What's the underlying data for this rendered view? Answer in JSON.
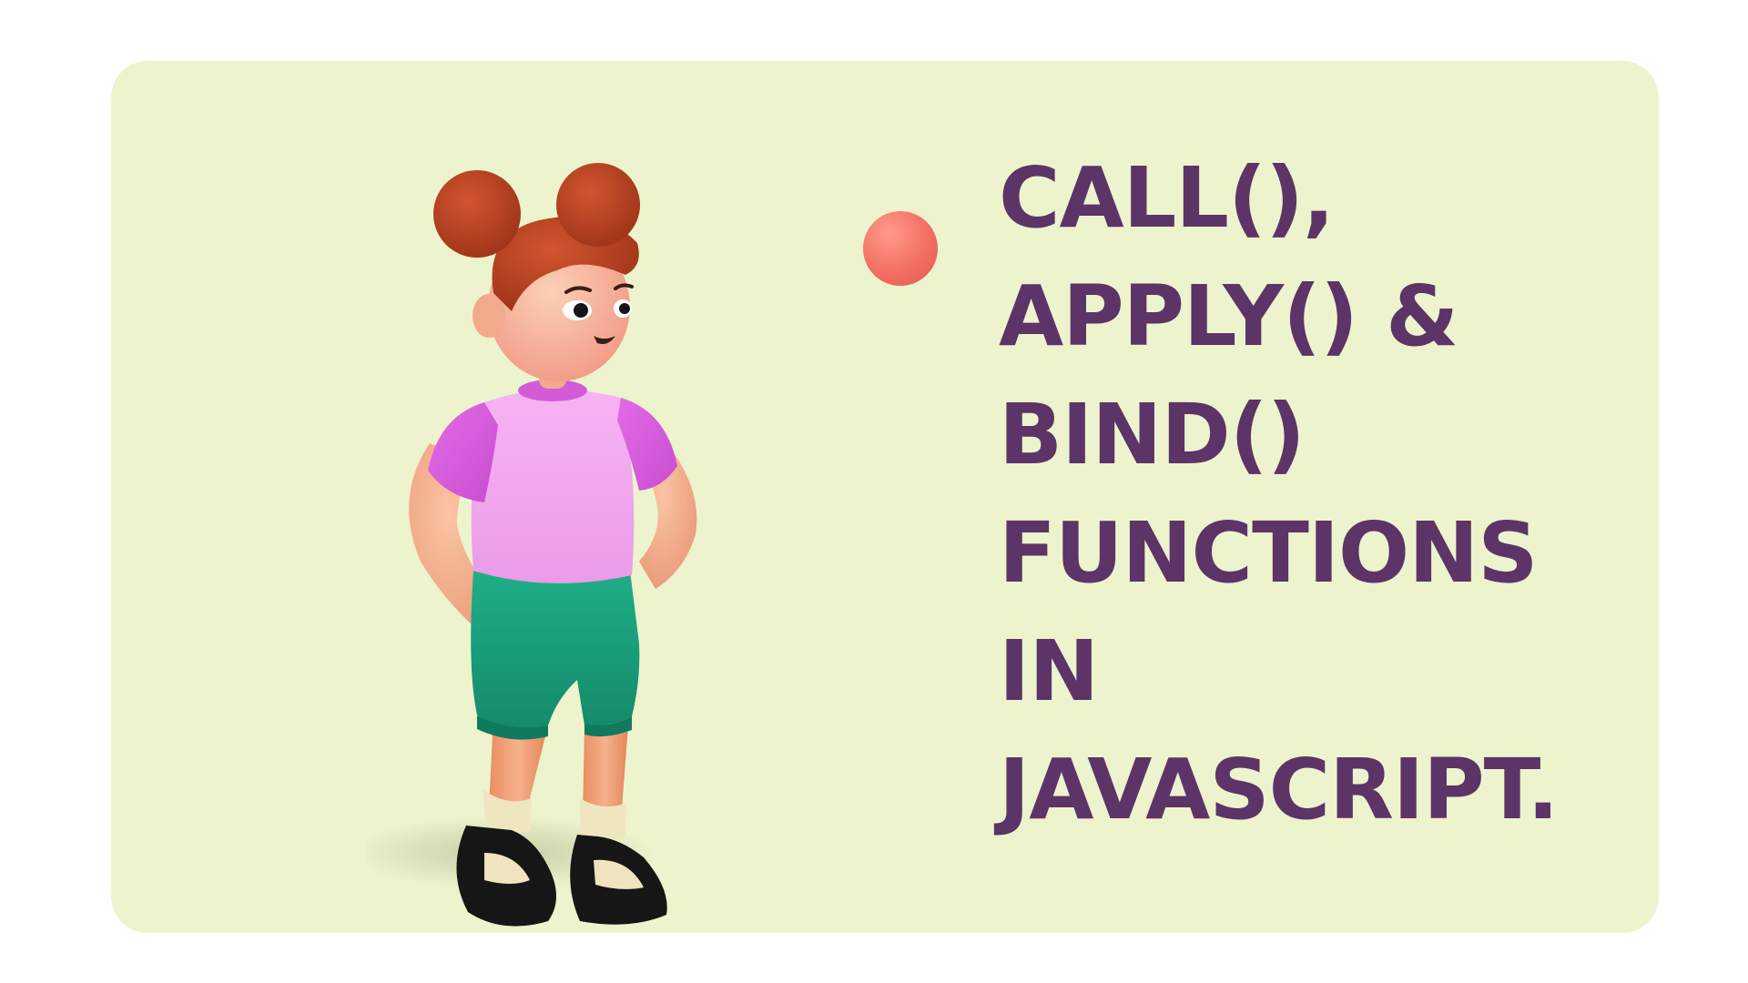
{
  "colors": {
    "page_background": "#ffffff",
    "card_background": "#edf3cd",
    "headline_text": "#5c3467",
    "accent_dot": "#f36f63"
  },
  "illustration": {
    "subject": "3D cartoon girl with red hair buns, pink t-shirt, green shorts and black shoes",
    "icon": "girl-character-illustration"
  },
  "headline": {
    "lines": [
      "CALL(),",
      "APPLY() &",
      "BIND()",
      "FUNCTIONS",
      "IN",
      "JAVASCRIPT."
    ]
  }
}
